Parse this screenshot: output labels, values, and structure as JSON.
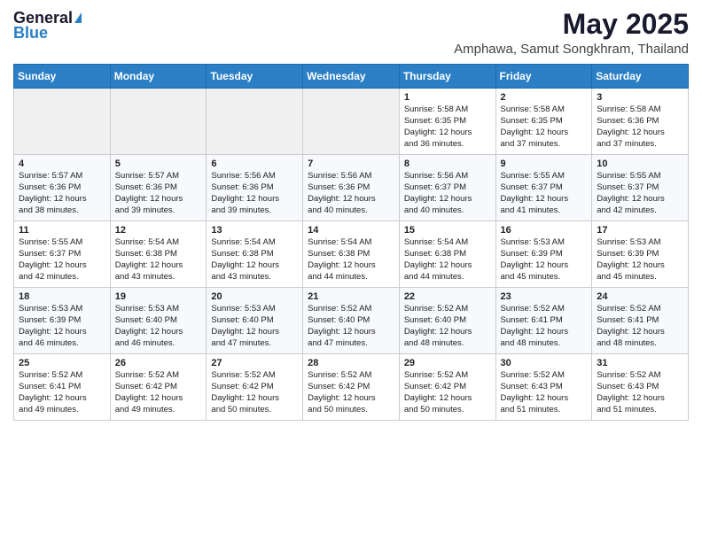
{
  "header": {
    "logo_general": "General",
    "logo_blue": "Blue",
    "month_title": "May 2025",
    "location": "Amphawa, Samut Songkhram, Thailand"
  },
  "days_of_week": [
    "Sunday",
    "Monday",
    "Tuesday",
    "Wednesday",
    "Thursday",
    "Friday",
    "Saturday"
  ],
  "weeks": [
    [
      {
        "day": "",
        "info": ""
      },
      {
        "day": "",
        "info": ""
      },
      {
        "day": "",
        "info": ""
      },
      {
        "day": "",
        "info": ""
      },
      {
        "day": "1",
        "info": "Sunrise: 5:58 AM\nSunset: 6:35 PM\nDaylight: 12 hours\nand 36 minutes."
      },
      {
        "day": "2",
        "info": "Sunrise: 5:58 AM\nSunset: 6:35 PM\nDaylight: 12 hours\nand 37 minutes."
      },
      {
        "day": "3",
        "info": "Sunrise: 5:58 AM\nSunset: 6:36 PM\nDaylight: 12 hours\nand 37 minutes."
      }
    ],
    [
      {
        "day": "4",
        "info": "Sunrise: 5:57 AM\nSunset: 6:36 PM\nDaylight: 12 hours\nand 38 minutes."
      },
      {
        "day": "5",
        "info": "Sunrise: 5:57 AM\nSunset: 6:36 PM\nDaylight: 12 hours\nand 39 minutes."
      },
      {
        "day": "6",
        "info": "Sunrise: 5:56 AM\nSunset: 6:36 PM\nDaylight: 12 hours\nand 39 minutes."
      },
      {
        "day": "7",
        "info": "Sunrise: 5:56 AM\nSunset: 6:36 PM\nDaylight: 12 hours\nand 40 minutes."
      },
      {
        "day": "8",
        "info": "Sunrise: 5:56 AM\nSunset: 6:37 PM\nDaylight: 12 hours\nand 40 minutes."
      },
      {
        "day": "9",
        "info": "Sunrise: 5:55 AM\nSunset: 6:37 PM\nDaylight: 12 hours\nand 41 minutes."
      },
      {
        "day": "10",
        "info": "Sunrise: 5:55 AM\nSunset: 6:37 PM\nDaylight: 12 hours\nand 42 minutes."
      }
    ],
    [
      {
        "day": "11",
        "info": "Sunrise: 5:55 AM\nSunset: 6:37 PM\nDaylight: 12 hours\nand 42 minutes."
      },
      {
        "day": "12",
        "info": "Sunrise: 5:54 AM\nSunset: 6:38 PM\nDaylight: 12 hours\nand 43 minutes."
      },
      {
        "day": "13",
        "info": "Sunrise: 5:54 AM\nSunset: 6:38 PM\nDaylight: 12 hours\nand 43 minutes."
      },
      {
        "day": "14",
        "info": "Sunrise: 5:54 AM\nSunset: 6:38 PM\nDaylight: 12 hours\nand 44 minutes."
      },
      {
        "day": "15",
        "info": "Sunrise: 5:54 AM\nSunset: 6:38 PM\nDaylight: 12 hours\nand 44 minutes."
      },
      {
        "day": "16",
        "info": "Sunrise: 5:53 AM\nSunset: 6:39 PM\nDaylight: 12 hours\nand 45 minutes."
      },
      {
        "day": "17",
        "info": "Sunrise: 5:53 AM\nSunset: 6:39 PM\nDaylight: 12 hours\nand 45 minutes."
      }
    ],
    [
      {
        "day": "18",
        "info": "Sunrise: 5:53 AM\nSunset: 6:39 PM\nDaylight: 12 hours\nand 46 minutes."
      },
      {
        "day": "19",
        "info": "Sunrise: 5:53 AM\nSunset: 6:40 PM\nDaylight: 12 hours\nand 46 minutes."
      },
      {
        "day": "20",
        "info": "Sunrise: 5:53 AM\nSunset: 6:40 PM\nDaylight: 12 hours\nand 47 minutes."
      },
      {
        "day": "21",
        "info": "Sunrise: 5:52 AM\nSunset: 6:40 PM\nDaylight: 12 hours\nand 47 minutes."
      },
      {
        "day": "22",
        "info": "Sunrise: 5:52 AM\nSunset: 6:40 PM\nDaylight: 12 hours\nand 48 minutes."
      },
      {
        "day": "23",
        "info": "Sunrise: 5:52 AM\nSunset: 6:41 PM\nDaylight: 12 hours\nand 48 minutes."
      },
      {
        "day": "24",
        "info": "Sunrise: 5:52 AM\nSunset: 6:41 PM\nDaylight: 12 hours\nand 48 minutes."
      }
    ],
    [
      {
        "day": "25",
        "info": "Sunrise: 5:52 AM\nSunset: 6:41 PM\nDaylight: 12 hours\nand 49 minutes."
      },
      {
        "day": "26",
        "info": "Sunrise: 5:52 AM\nSunset: 6:42 PM\nDaylight: 12 hours\nand 49 minutes."
      },
      {
        "day": "27",
        "info": "Sunrise: 5:52 AM\nSunset: 6:42 PM\nDaylight: 12 hours\nand 50 minutes."
      },
      {
        "day": "28",
        "info": "Sunrise: 5:52 AM\nSunset: 6:42 PM\nDaylight: 12 hours\nand 50 minutes."
      },
      {
        "day": "29",
        "info": "Sunrise: 5:52 AM\nSunset: 6:42 PM\nDaylight: 12 hours\nand 50 minutes."
      },
      {
        "day": "30",
        "info": "Sunrise: 5:52 AM\nSunset: 6:43 PM\nDaylight: 12 hours\nand 51 minutes."
      },
      {
        "day": "31",
        "info": "Sunrise: 5:52 AM\nSunset: 6:43 PM\nDaylight: 12 hours\nand 51 minutes."
      }
    ]
  ]
}
